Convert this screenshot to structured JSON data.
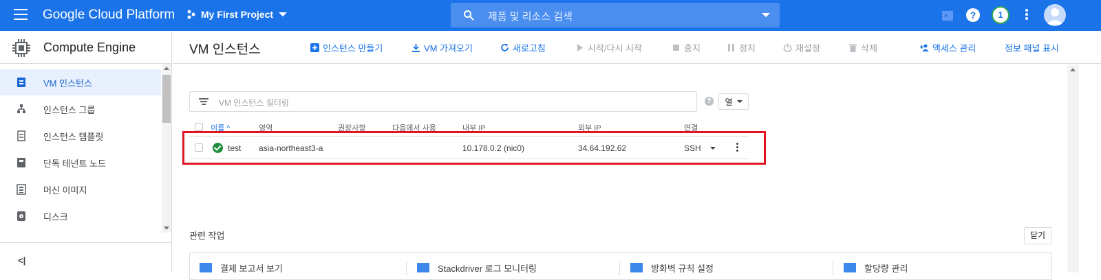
{
  "topbar": {
    "brand": "Google Cloud Platform",
    "project": "My First Project",
    "search_placeholder": "제품 및 리소스 검색",
    "help": "?",
    "notifications": "1"
  },
  "sidebar": {
    "product": "Compute Engine",
    "items": [
      {
        "label": "VM 인스턴스",
        "icon": "vm-instance-icon",
        "active": true
      },
      {
        "label": "인스턴스 그룹",
        "icon": "instance-group-icon"
      },
      {
        "label": "인스턴스 템플릿",
        "icon": "template-icon"
      },
      {
        "label": "단독 테넌트 노드",
        "icon": "sole-tenant-icon"
      },
      {
        "label": "머신 이미지",
        "icon": "machine-image-icon"
      },
      {
        "label": "디스크",
        "icon": "disk-icon"
      }
    ],
    "collapse": "<|"
  },
  "toolbar": {
    "title": "VM 인스턴스",
    "create": "인스턴스 만들기",
    "import": "VM 가져오기",
    "refresh": "새로고침",
    "start": "시작/다시 시작",
    "stop": "중지",
    "pause": "정지",
    "reset": "재설정",
    "delete": "삭제",
    "access": "액세스 관리",
    "info_panel": "정보 패널 표시"
  },
  "filter": {
    "placeholder": "VM 인스턴스 필터링",
    "help": "?",
    "columns_label": "열"
  },
  "table": {
    "headers": [
      "이름 ^",
      "영역",
      "권장사항",
      "다음에서 사용",
      "내부 IP",
      "외부 IP",
      "연결"
    ],
    "rows": [
      {
        "name": "test",
        "zone": "asia-northeast3-a",
        "recommendation": "",
        "in_use_by": "",
        "internal_ip": "10.178.0.2 (nic0)",
        "external_ip": "34.64.192.62",
        "connect": "SSH",
        "status": "running"
      }
    ]
  },
  "related": {
    "title": "관련 작업",
    "close": "닫기",
    "cards": [
      "결제 보고서 보기",
      "Stackdriver 로그 모니터링",
      "방화벽 규칙 설정",
      "할당량 관리"
    ]
  },
  "colors": {
    "accent": "#1a73e8",
    "highlight": "#e3141f",
    "status_ok": "#1e8e3e"
  }
}
